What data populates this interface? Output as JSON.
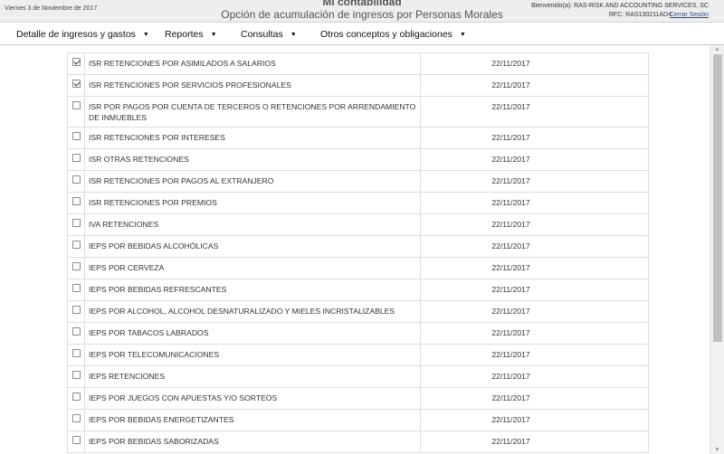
{
  "header": {
    "date": "Viernes 3 de Noviembre de 2017",
    "title": "Mi contabilidad",
    "subtitle": "Opción de acumulación de ingresos por Personas Morales",
    "welcome": "Bienvenido(a): RAS-RISK AND ACCOUNTING SERVICES, SC",
    "rfc": "RFC: RAS130211AD4",
    "logout": "Cerrar Sesión"
  },
  "nav": {
    "items": [
      {
        "label": "Detalle de ingresos y gastos",
        "icon": "caret-down-icon"
      },
      {
        "label": "Reportes",
        "icon": "caret-down-icon"
      },
      {
        "label": "Consultas",
        "icon": "caret-down-icon"
      },
      {
        "label": "Otros conceptos y obligaciones",
        "icon": "caret-down-icon"
      }
    ]
  },
  "rows": [
    {
      "checked": true,
      "name": "ISR RETENCIONES POR ASIMILADOS A SALARIOS",
      "date": "22/11/2017"
    },
    {
      "checked": true,
      "name": "ISR RETENCIONES POR SERVICIOS PROFESIONALES",
      "date": "22/11/2017"
    },
    {
      "checked": false,
      "name": "ISR POR PAGOS POR CUENTA DE TERCEROS O RETENCIONES POR ARRENDAMIENTO DE INMUEBLES",
      "date": "22/11/2017"
    },
    {
      "checked": false,
      "name": "ISR RETENCIONES POR INTERESES",
      "date": "22/11/2017"
    },
    {
      "checked": false,
      "name": "ISR OTRAS RETENCIONES",
      "date": "22/11/2017"
    },
    {
      "checked": false,
      "name": "ISR RETENCIONES POR PAGOS AL EXTRANJERO",
      "date": "22/11/2017"
    },
    {
      "checked": false,
      "name": "ISR RETENCIONES POR PREMIOS",
      "date": "22/11/2017"
    },
    {
      "checked": false,
      "name": "IVA RETENCIONES",
      "date": "22/11/2017"
    },
    {
      "checked": false,
      "name": "IEPS POR BEBIDAS ALCOHÓLICAS",
      "date": "22/11/2017"
    },
    {
      "checked": false,
      "name": "IEPS POR CERVEZA",
      "date": "22/11/2017"
    },
    {
      "checked": false,
      "name": "IEPS POR BEBIDAS REFRESCANTES",
      "date": "22/11/2017"
    },
    {
      "checked": false,
      "name": "IEPS POR ALCOHOL, ALCOHOL DESNATURALIZADO Y MIELES INCRISTALIZABLES",
      "date": "22/11/2017"
    },
    {
      "checked": false,
      "name": "IEPS POR TABACOS LABRADOS",
      "date": "22/11/2017"
    },
    {
      "checked": false,
      "name": "IEPS POR TELECOMUNICACIONES",
      "date": "22/11/2017"
    },
    {
      "checked": false,
      "name": "IEPS RETENCIONES",
      "date": "22/11/2017"
    },
    {
      "checked": false,
      "name": "IEPS POR JUEGOS CON APUESTAS Y/O SORTEOS",
      "date": "22/11/2017"
    },
    {
      "checked": false,
      "name": "IEPS POR BEBIDAS ENERGETIZANTES",
      "date": "22/11/2017"
    },
    {
      "checked": false,
      "name": "IEPS POR BEBIDAS SABORIZADAS",
      "date": "22/11/2017"
    }
  ],
  "scrollbar": {
    "up_icon": "scroll-up-arrow-icon",
    "down_icon": "scroll-down-arrow-icon"
  },
  "colors": {
    "header_bg": "#eeeeee",
    "link": "#2a4d8f",
    "border": "#dddddd",
    "scroll_thumb": "#c1c1c1"
  }
}
